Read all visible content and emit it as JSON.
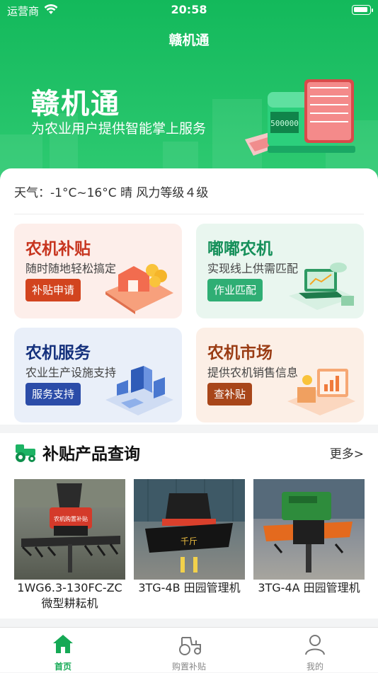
{
  "status_bar": {
    "carrier": "运营商",
    "time": "20:58"
  },
  "nav": {
    "title": "赣机通"
  },
  "hero": {
    "title": "赣机通",
    "subtitle": "为农业用户提供智能掌上服务",
    "machine_counter": "500000"
  },
  "weather": {
    "text": "天气：-1°C~16°C 晴 风力等级４级"
  },
  "tiles": [
    {
      "title": "农机补贴",
      "subtitle": "随时随地轻松搞定",
      "button": "补贴申请",
      "title_color": "#c7351f",
      "button_color": "#d2441f",
      "bg": "#fdeeea"
    },
    {
      "title": "嘟嘟农机",
      "subtitle": "实现线上供需匹配",
      "button": "作业匹配",
      "title_color": "#16905a",
      "button_color": "#2fae74",
      "bg": "#e9f6ef"
    },
    {
      "title": "农机服务",
      "subtitle": "农业生产设施支持",
      "button": "服务支持",
      "title_color": "#15317d",
      "button_color": "#2b4ca8",
      "bg": "#e9eff9"
    },
    {
      "title": "农机市场",
      "subtitle": "提供农机销售信息",
      "button": "查补贴",
      "title_color": "#9a3c14",
      "button_color": "#a8461a",
      "bg": "#fcefe6"
    }
  ],
  "products_section": {
    "title": "补贴产品查询",
    "more": "更多>",
    "items": [
      {
        "name": "1WG6.3-130FC-ZC 微型耕耘机",
        "photo_label": "农机购置补贴"
      },
      {
        "name": "3TG-4B 田园管理机",
        "photo_label": "千斤"
      },
      {
        "name": "3TG-4A 田园管理机",
        "photo_label": ""
      }
    ]
  },
  "tabbar": {
    "items": [
      {
        "label": "首页",
        "icon": "home-icon",
        "active": true
      },
      {
        "label": "购置补贴",
        "icon": "tractor-icon",
        "active": false
      },
      {
        "label": "我的",
        "icon": "person-icon",
        "active": false
      }
    ],
    "active_color": "#15a955",
    "inactive_color": "#888888"
  }
}
